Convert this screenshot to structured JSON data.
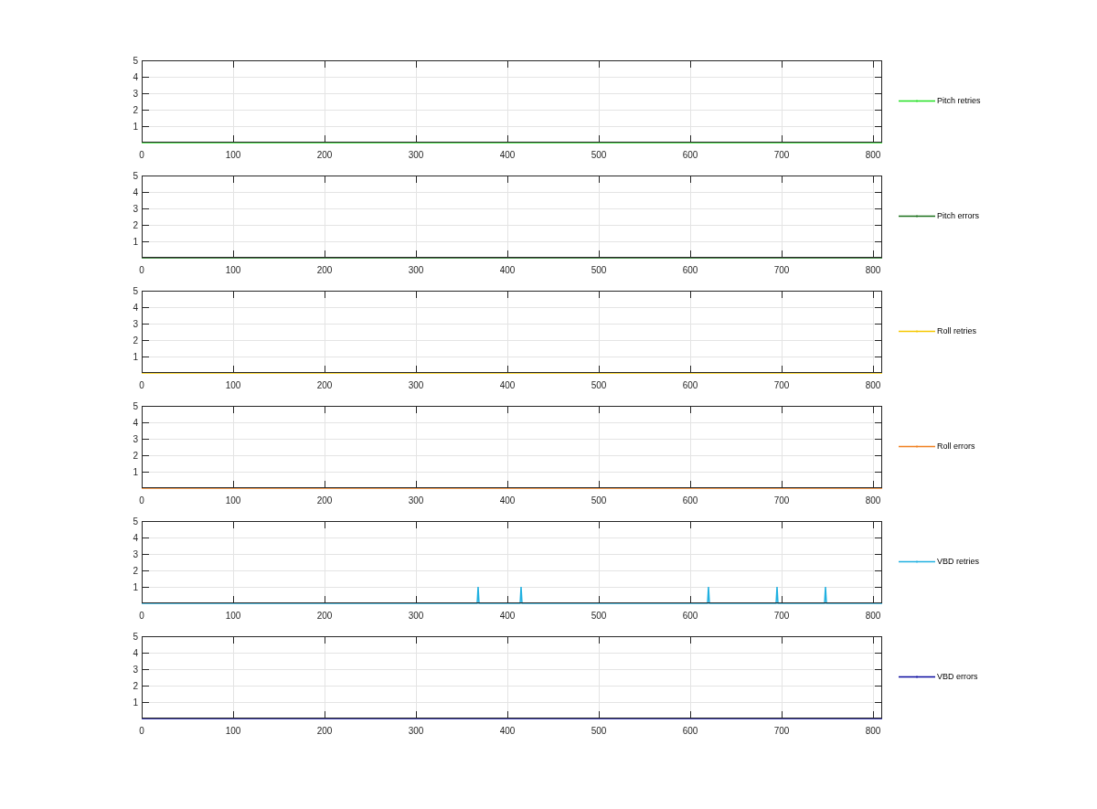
{
  "subplots": [
    {
      "chart_data": {
        "type": "line",
        "grid": true,
        "xlim": [
          0,
          810
        ],
        "ylim": [
          0,
          5
        ],
        "xticks": [
          0,
          100,
          200,
          300,
          400,
          500,
          600,
          700,
          800
        ],
        "yticks": [
          1,
          2,
          3,
          4,
          5
        ],
        "x": [
          0,
          810
        ],
        "series": [
          {
            "name": "Pitch retries",
            "color": "#22e022",
            "values": [
              0,
              0
            ]
          }
        ]
      }
    },
    {
      "chart_data": {
        "type": "line",
        "grid": true,
        "xlim": [
          0,
          810
        ],
        "ylim": [
          0,
          5
        ],
        "xticks": [
          0,
          100,
          200,
          300,
          400,
          500,
          600,
          700,
          800
        ],
        "yticks": [
          1,
          2,
          3,
          4,
          5
        ],
        "x": [
          0,
          810
        ],
        "series": [
          {
            "name": "Pitch errors",
            "color": "#1a701a",
            "values": [
              0,
              0
            ]
          }
        ]
      }
    },
    {
      "chart_data": {
        "type": "line",
        "grid": true,
        "xlim": [
          0,
          810
        ],
        "ylim": [
          0,
          5
        ],
        "xticks": [
          0,
          100,
          200,
          300,
          400,
          500,
          600,
          700,
          800
        ],
        "yticks": [
          1,
          2,
          3,
          4,
          5
        ],
        "x": [
          0,
          810
        ],
        "series": [
          {
            "name": "Roll retries",
            "color": "#f5c800",
            "values": [
              0,
              0
            ]
          }
        ]
      }
    },
    {
      "chart_data": {
        "type": "line",
        "grid": true,
        "xlim": [
          0,
          810
        ],
        "ylim": [
          0,
          5
        ],
        "xticks": [
          0,
          100,
          200,
          300,
          400,
          500,
          600,
          700,
          800
        ],
        "yticks": [
          1,
          2,
          3,
          4,
          5
        ],
        "x": [
          0,
          810
        ],
        "series": [
          {
            "name": "Roll errors",
            "color": "#f08020",
            "values": [
              0,
              0
            ]
          }
        ]
      }
    },
    {
      "chart_data": {
        "type": "line",
        "grid": true,
        "xlim": [
          0,
          810
        ],
        "ylim": [
          0,
          5
        ],
        "xticks": [
          0,
          100,
          200,
          300,
          400,
          500,
          600,
          700,
          800
        ],
        "yticks": [
          1,
          2,
          3,
          4,
          5
        ],
        "x": [
          0,
          367,
          368,
          369,
          414,
          415,
          416,
          619,
          620,
          621,
          694,
          695,
          696,
          747,
          748,
          749,
          810
        ],
        "series": [
          {
            "name": "VBD retries",
            "color": "#20b0e0",
            "values": [
              0,
              0,
              1,
              0,
              0,
              1,
              0,
              0,
              1,
              0,
              0,
              1,
              0,
              0,
              1,
              0,
              0
            ]
          }
        ]
      }
    },
    {
      "chart_data": {
        "type": "line",
        "grid": true,
        "xlim": [
          0,
          810
        ],
        "ylim": [
          0,
          5
        ],
        "xticks": [
          0,
          100,
          200,
          300,
          400,
          500,
          600,
          700,
          800
        ],
        "yticks": [
          1,
          2,
          3,
          4,
          5
        ],
        "x": [
          0,
          810
        ],
        "series": [
          {
            "name": "VBD errors",
            "color": "#0a0aa0",
            "values": [
              0,
              0
            ]
          }
        ]
      }
    }
  ]
}
